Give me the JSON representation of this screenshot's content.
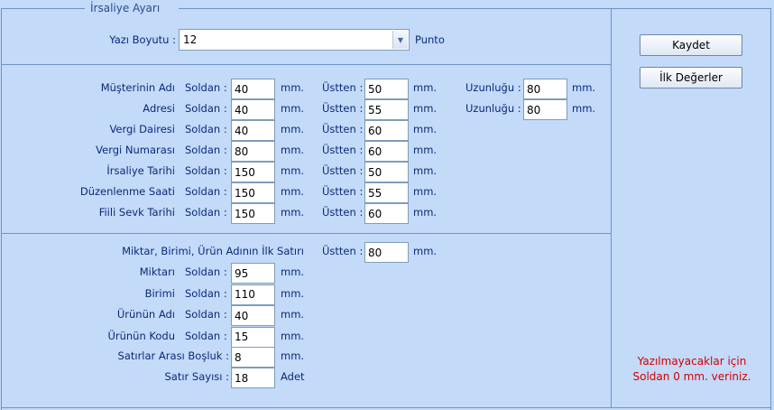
{
  "group_title": "İrsaliye Ayarı",
  "font": {
    "label": "Yazı Boyutu :",
    "value": "12",
    "unit": "Punto"
  },
  "text": {
    "soldan": "Soldan :",
    "ustten": "Üstten :",
    "mm": "mm.",
    "uzunlugu": "Uzunluğu :",
    "adet": "Adet"
  },
  "header_rows": [
    {
      "label": "Müşterinin Adı",
      "soldan": "40",
      "ustten": "50",
      "uzunluk": "80"
    },
    {
      "label": "Adresi",
      "soldan": "40",
      "ustten": "55",
      "uzunluk": "80"
    },
    {
      "label": "Vergi Dairesi",
      "soldan": "40",
      "ustten": "60"
    },
    {
      "label": "Vergi Numarası",
      "soldan": "80",
      "ustten": "60"
    },
    {
      "label": "İrsaliye Tarihi",
      "soldan": "150",
      "ustten": "50"
    },
    {
      "label": "Düzenlenme Saati",
      "soldan": "150",
      "ustten": "55"
    },
    {
      "label": "Fiili Sevk Tarihi",
      "soldan": "150",
      "ustten": "60"
    }
  ],
  "first_row": {
    "label": "Miktar, Birimi, Ürün Adının İlk Satırı",
    "ustten": "80"
  },
  "item_rows": [
    {
      "label": "Miktarı",
      "value": "95"
    },
    {
      "label": "Birimi",
      "value": "110"
    },
    {
      "label": "Ürünün Adı",
      "value": "40"
    },
    {
      "label": "Ürünün Kodu",
      "value": "15"
    }
  ],
  "spacing": {
    "label": "Satırlar Arası Boşluk :",
    "value": "8"
  },
  "row_count": {
    "label": "Satır Sayısı :",
    "value": "18"
  },
  "buttons": {
    "save": "Kaydet",
    "defaults": "İlk Değerler"
  },
  "note": "Yazılmayacaklar için Soldan 0 mm. veriniz."
}
